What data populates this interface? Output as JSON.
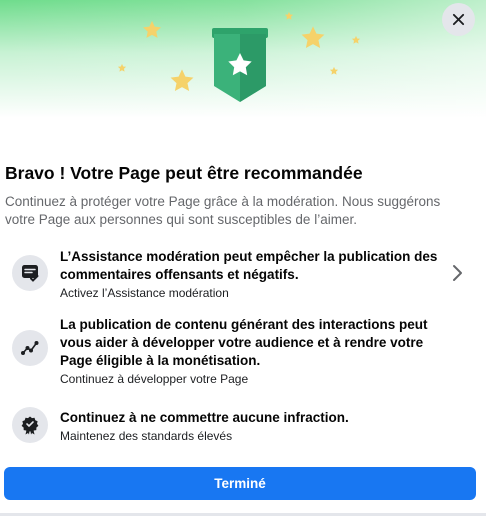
{
  "dialog": {
    "title": "Bravo ! Votre Page peut être recommandée",
    "subtitle": "Continuez à protéger votre Page grâce à la modération. Nous suggérons votre Page aux personnes qui sont susceptibles de l’aimer.",
    "items": [
      {
        "icon": "moderation-icon",
        "heading": "L’Assistance modération peut empêcher la publication des commentaires offensants et négatifs.",
        "subtext": "Activez l’Assistance modération",
        "has_chevron": true
      },
      {
        "icon": "growth-chart-icon",
        "heading": "La publication de contenu générant des interactions peut vous aider à développer votre audience et à rendre votre Page éligible à la monétisation.",
        "subtext": "Continuez à développer votre Page",
        "has_chevron": false
      },
      {
        "icon": "award-ribbon-icon",
        "heading": "Continuez à ne commettre aucune infraction.",
        "subtext": "Maintenez des standards élevés",
        "has_chevron": false
      }
    ],
    "done_label": "Terminé"
  },
  "icons": {
    "close": "close-icon",
    "badge": "star-badge-icon",
    "chevron": "chevron-right-icon"
  },
  "colors": {
    "accent": "#1877f2",
    "hero_green": "#6fdc8c",
    "badge_green": "#2ea36b",
    "star_gold": "#f5d26a"
  }
}
